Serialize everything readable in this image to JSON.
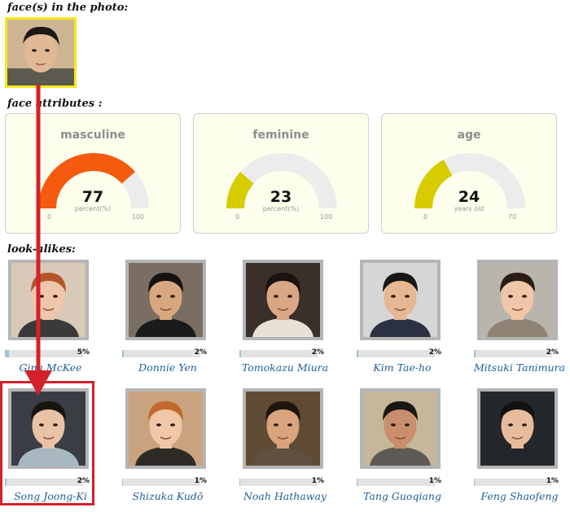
{
  "headings": {
    "faces_in_photo": "face(s) in the photo:",
    "face_attributes": "face attributes :",
    "look_alikes": "look-alikes:"
  },
  "gauges": [
    {
      "title": "masculine",
      "value": "77",
      "unit": "percent(%)",
      "min": "0",
      "max": "100",
      "fraction": 0.77,
      "color": "#f45b0e"
    },
    {
      "title": "feminine",
      "value": "23",
      "unit": "percent(%)",
      "min": "0",
      "max": "100",
      "fraction": 0.23,
      "color": "#d6cc00"
    },
    {
      "title": "age",
      "value": "24",
      "unit": "years old",
      "min": "0",
      "max": "70",
      "fraction": 0.343,
      "color": "#d6cc00"
    }
  ],
  "lookalikes": [
    {
      "name": "Gina McKee",
      "percent": "5%",
      "score": 0.05
    },
    {
      "name": "Donnie Yen",
      "percent": "2%",
      "score": 0.02
    },
    {
      "name": "Tomokazu Miura",
      "percent": "2%",
      "score": 0.02
    },
    {
      "name": "Kim Tae-ho",
      "percent": "2%",
      "score": 0.02
    },
    {
      "name": "Mitsuki Tanimura",
      "percent": "2%",
      "score": 0.02
    },
    {
      "name": "Song Joong-Ki",
      "percent": "2%",
      "score": 0.02
    },
    {
      "name": "Shizuka Kudō",
      "percent": "1%",
      "score": 0.01
    },
    {
      "name": "Noah Hathaway",
      "percent": "1%",
      "score": 0.01
    },
    {
      "name": "Tang Guoqiang",
      "percent": "1%",
      "score": 0.01
    },
    {
      "name": "Feng Shaofeng",
      "percent": "1%",
      "score": 0.01
    }
  ],
  "colors": {
    "gauge_track": "#ececec",
    "highlight": "#d4202a",
    "face_frame": "#f5ea1d",
    "link": "#1f5f96"
  }
}
